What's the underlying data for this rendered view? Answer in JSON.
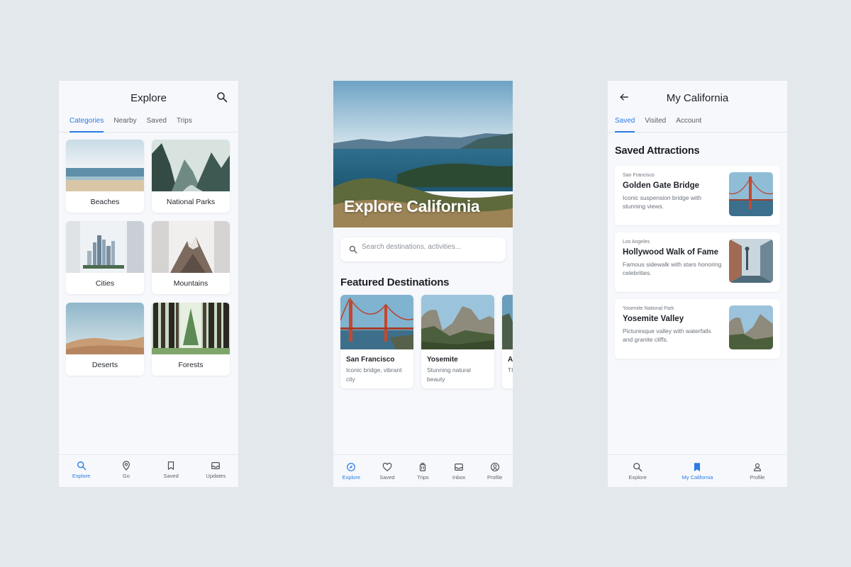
{
  "colors": {
    "accent": "#2c7be5",
    "background": "#e3e8ec",
    "screen": "#f6f8fc"
  },
  "explore_screen": {
    "title": "Explore",
    "search_icon": "search-icon",
    "tabs": [
      {
        "label": "Categories",
        "active": true
      },
      {
        "label": "Nearby",
        "active": false
      },
      {
        "label": "Saved",
        "active": false
      },
      {
        "label": "Trips",
        "active": false
      }
    ],
    "categories": [
      {
        "label": "Beaches"
      },
      {
        "label": "National Parks"
      },
      {
        "label": "Cities"
      },
      {
        "label": "Mountains"
      },
      {
        "label": "Deserts"
      },
      {
        "label": "Forests"
      }
    ],
    "nav": [
      {
        "label": "Explore",
        "icon": "search-icon",
        "active": true
      },
      {
        "label": "Go",
        "icon": "map-pin-icon",
        "active": false
      },
      {
        "label": "Saved",
        "icon": "bookmark-icon",
        "active": false
      },
      {
        "label": "Updates",
        "icon": "inbox-icon",
        "active": false
      }
    ]
  },
  "home_screen": {
    "hero_title": "Explore California",
    "search_placeholder": "Search destinations, activities...",
    "featured_heading": "Featured Destinations",
    "destinations": [
      {
        "name": "San Francisco",
        "desc": "Iconic bridge, vibrant city"
      },
      {
        "name": "Yosemite",
        "desc": "Stunning natural beauty"
      },
      {
        "name": "A",
        "desc": "Th ar"
      }
    ],
    "nav": [
      {
        "label": "Explore",
        "icon": "compass-icon",
        "active": true
      },
      {
        "label": "Saved",
        "icon": "heart-icon",
        "active": false
      },
      {
        "label": "Trips",
        "icon": "luggage-icon",
        "active": false
      },
      {
        "label": "Inbox",
        "icon": "inbox-icon",
        "active": false
      },
      {
        "label": "Profile",
        "icon": "profile-icon",
        "active": false
      }
    ]
  },
  "my_california_screen": {
    "title": "My California",
    "back_icon": "arrow-left-icon",
    "tabs": [
      {
        "label": "Saved",
        "active": true
      },
      {
        "label": "Visited",
        "active": false
      },
      {
        "label": "Account",
        "active": false
      }
    ],
    "section_heading": "Saved Attractions",
    "attractions": [
      {
        "location": "San Francisco",
        "name": "Golden Gate Bridge",
        "desc": "Iconic suspension bridge with stunning views."
      },
      {
        "location": "Los Angeles",
        "name": "Hollywood Walk of Fame",
        "desc": "Famous sidewalk with stars honoring celebrities."
      },
      {
        "location": "Yosemite National Park",
        "name": "Yosemite Valley",
        "desc": "Picturesque valley with waterfalls and granite cliffs."
      }
    ],
    "nav": [
      {
        "label": "Explore",
        "icon": "search-icon",
        "active": false
      },
      {
        "label": "My California",
        "icon": "bookmark-icon",
        "active": true
      },
      {
        "label": "Profile",
        "icon": "profile-icon",
        "active": false
      }
    ]
  }
}
